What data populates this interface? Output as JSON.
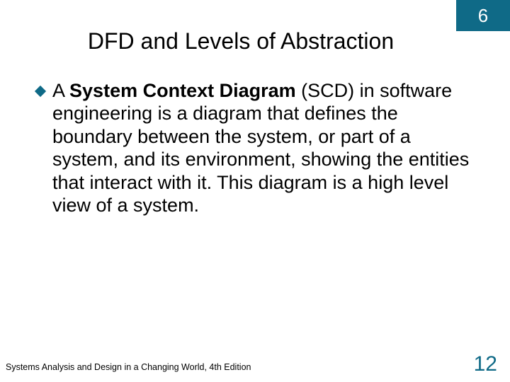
{
  "chapter_number": "6",
  "slide_title": "DFD and Levels of Abstraction",
  "bullet": {
    "prefix": "A ",
    "bold": "System Context Diagram",
    "rest": " (SCD) in software engineering is a diagram that defines the boundary between the system, or part of a system, and its environment, showing the entities that interact with it. This diagram is a high level view of a system."
  },
  "footer_text": "Systems Analysis and Design in a Changing World, 4th Edition",
  "page_number": "12",
  "colors": {
    "accent": "#0f6a87"
  }
}
